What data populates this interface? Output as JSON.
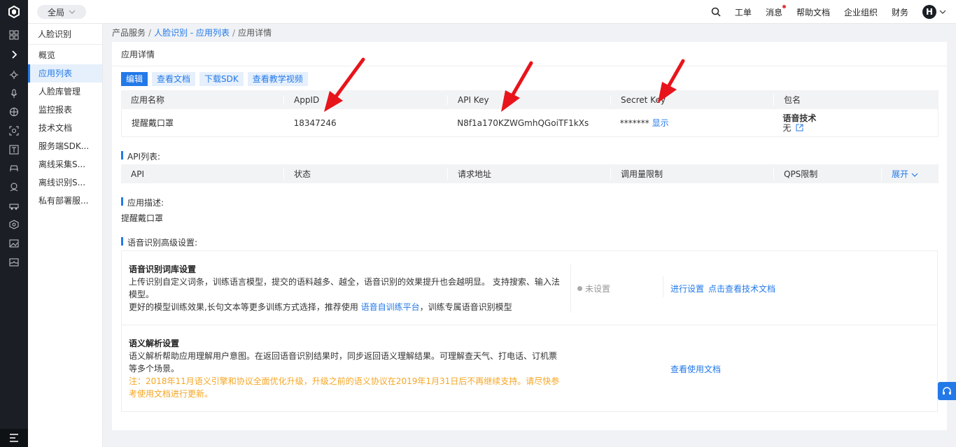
{
  "topbar": {
    "scope_label": "全局",
    "nav": [
      "工单",
      "消息",
      "帮助文档",
      "企业组织",
      "财务"
    ],
    "avatar_letter": "H"
  },
  "sidebar_icons": [
    "grid-icon",
    "chevron-right-icon",
    "bug-icon",
    "microphone-icon",
    "globe-icon",
    "face-scan-icon",
    "text-recognition-icon",
    "car-icon",
    "face-icon",
    "vehicle-icon",
    "package-icon",
    "image-icon",
    "video-icon"
  ],
  "subnav": {
    "title": "人脸识别",
    "items": [
      "概览",
      "应用列表",
      "人脸库管理",
      "监控报表",
      "技术文档",
      "服务端SDK...",
      "离线采集S...",
      "离线识别S...",
      "私有部署服..."
    ],
    "active_index": 1
  },
  "breadcrumb": {
    "root": "产品服务",
    "middle": "人脸识别 - 应用列表",
    "current": "应用详情",
    "separator": "/"
  },
  "panel": {
    "title": "应用详情",
    "buttons": [
      "编辑",
      "查看文档",
      "下载SDK",
      "查看教学视频"
    ]
  },
  "app_table": {
    "headers": [
      "应用名称",
      "AppID",
      "API Key",
      "Secret Key",
      "包名"
    ],
    "row": {
      "name": "提醒戴口罩",
      "app_id": "18347246",
      "api_key": "N8f1a170KZWGmhQGoiTF1kXs",
      "secret_masked": "*******",
      "secret_show": "显示",
      "package_title": "语音技术",
      "package_value": "无"
    }
  },
  "api_list": {
    "label": "API列表:",
    "headers": [
      "API",
      "状态",
      "请求地址",
      "调用量限制",
      "QPS限制"
    ],
    "expand": "展开"
  },
  "description": {
    "label": "应用描述:",
    "value": "提醒戴口罩"
  },
  "advanced": {
    "label": "语音识别高级设置:",
    "vocab": {
      "title": "语音识别词库设置",
      "line1": "上传识别自定义词条，训练语言模型，提交的语料越多、越全，语音识别的效果提升也会越明显。 支持搜索、输入法模型。",
      "line2_prefix": "更好的模型训练效果,长句文本等更多训练方式选择，推荐使用 ",
      "line2_link": "语音自训练平台",
      "line2_suffix": "，训练专属语音识别模型",
      "status": "未设置",
      "action1": "进行设置",
      "action2": "点击查看技术文档"
    },
    "semantic": {
      "title": "语义解析设置",
      "line1": "语义解析帮助应用理解用户意图。在返回语音识别结果时，同步返回语义理解结果。可理解查天气、打电话、订机票等多个场景。",
      "warning": "注：2018年11月语义引擎和协议全面优化升级，升级之前的语义协议在2019年1月31日后不再继续支持。请尽快参考使用文档进行更新。",
      "action": "查看使用文档"
    }
  },
  "colors": {
    "accent": "#2379e8",
    "arrow": "#e8141b",
    "warning": "#f5a623",
    "sidebar_bg": "#1b1f25"
  }
}
